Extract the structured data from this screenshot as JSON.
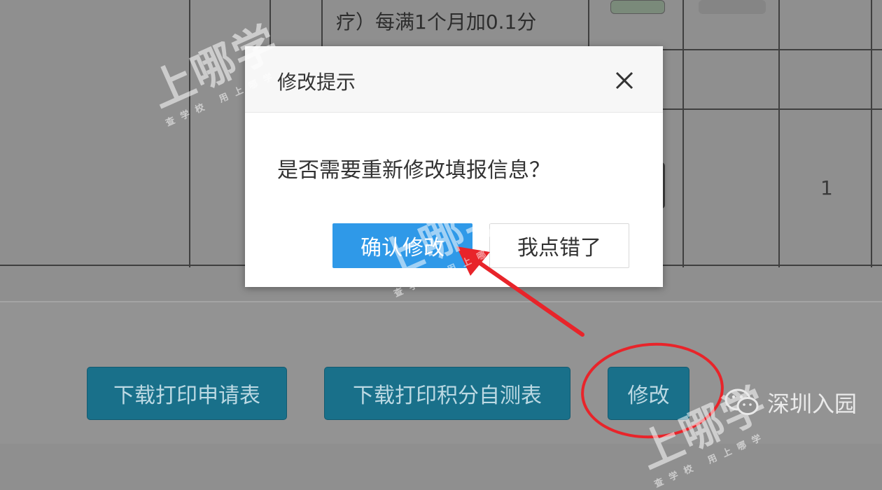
{
  "background": {
    "row_text": "疗）每满1个月加0.1分",
    "cell_value": "1"
  },
  "modal": {
    "title": "修改提示",
    "message": "是否需要重新修改填报信息？",
    "confirm_label": "确认修改",
    "cancel_label": "我点错了",
    "close_icon": "close-icon"
  },
  "actions": {
    "download_application": "下载打印申请表",
    "download_points": "下载打印积分自测表",
    "modify": "修改"
  },
  "watermark": {
    "brand": "上哪学",
    "tagline": "查学校 用上哪学"
  },
  "wechat": {
    "icon": "wechat-icon",
    "account": "深圳入园"
  },
  "colors": {
    "confirm": "#2f99e8",
    "action_button": "#19708a",
    "annotation": "#e8242a"
  }
}
